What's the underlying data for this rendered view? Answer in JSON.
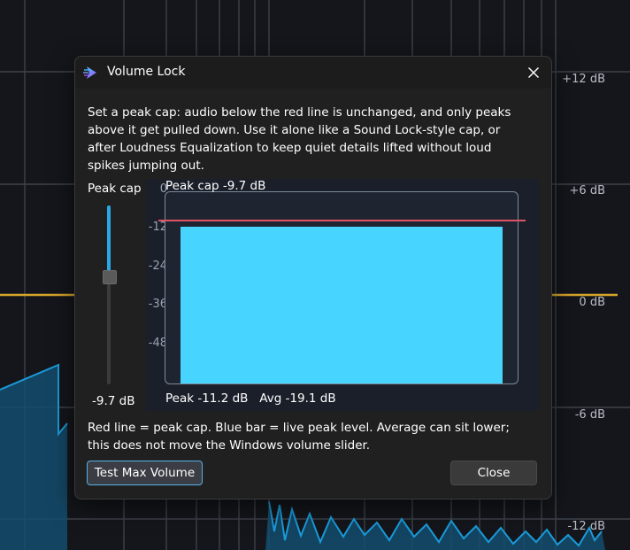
{
  "background": {
    "db_labels": [
      "+12 dB",
      "+6 dB",
      "0 dB",
      "-6 dB",
      "-12 dB"
    ],
    "accent_line_color": "#d8a52c",
    "spectrum_color": "#1b9ad9"
  },
  "dialog": {
    "title": "Volume Lock",
    "close_icon": "close-icon",
    "description": "Set a peak cap: audio below the red line is unchanged, and only peaks above it get pulled down. Use it alone like a Sound Lock-style cap, or after Loudness Equalization to keep quiet details lifted without loud spikes jumping out.",
    "slider": {
      "label": "Peak cap",
      "value_text": "-9.7 dB",
      "value_db": -9.7
    },
    "meter": {
      "scale_ticks": [
        "0",
        "-12",
        "-24",
        "-36",
        "-48"
      ],
      "cap_text": "Peak cap -9.7 dB",
      "peak_text": "Peak -11.2 dB",
      "avg_text": "Avg -19.1 dB",
      "cap_line_color": "#e05566",
      "bar_color": "#47d5ff"
    },
    "footnote": "Red line = peak cap. Blue bar = live peak level. Average can sit lower; this does not move the Windows volume slider.",
    "buttons": {
      "test": "Test Max Volume",
      "close": "Close"
    }
  }
}
